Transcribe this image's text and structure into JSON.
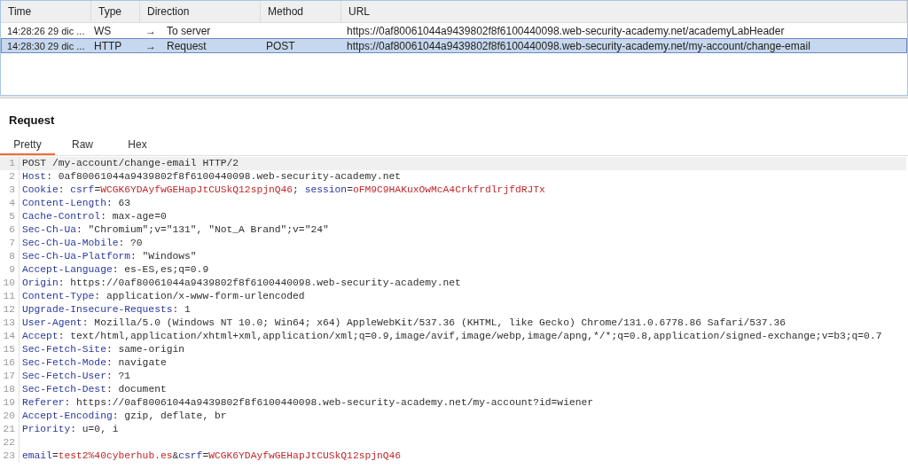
{
  "table": {
    "columns": [
      "Time",
      "Type",
      "Direction",
      "Method",
      "URL"
    ],
    "rows": [
      {
        "time": "14:28:26 29 dic ...",
        "type": "WS",
        "direction_arrow": "→",
        "direction": "To server",
        "url": "https://0af80061044a9439802f8f6100440098.web-security-academy.net/academyLabHeader",
        "selected": false
      },
      {
        "time": "14:28:30 29 dic ...",
        "type": "HTTP",
        "direction_arrow": "→",
        "direction": "Request",
        "method": "POST",
        "url": "https://0af80061044a9439802f8f6100440098.web-security-academy.net/my-account/change-email",
        "selected": true
      }
    ]
  },
  "panel": {
    "title": "Request",
    "tabs": [
      {
        "label": "Pretty",
        "selected": true
      },
      {
        "label": "Raw",
        "selected": false
      },
      {
        "label": "Hex",
        "selected": false
      }
    ],
    "lines": [
      {
        "number": "1",
        "tokens": [
          {
            "kind": "plain",
            "text": "POST /my-account/change-email HTTP/2"
          }
        ]
      },
      {
        "number": "2",
        "tokens": [
          {
            "kind": "name",
            "text": "Host"
          },
          {
            "kind": "plain",
            "text": ": 0af80061044a9439802f8f6100440098.web-security-academy.net"
          }
        ]
      },
      {
        "number": "3",
        "tokens": [
          {
            "kind": "name",
            "text": "Cookie"
          },
          {
            "kind": "plain",
            "text": ": "
          },
          {
            "kind": "name",
            "text": "csrf"
          },
          {
            "kind": "plain",
            "text": "="
          },
          {
            "kind": "value",
            "text": "WCGK6YDAyfwGEHapJtCUSkQ12spjnQ46"
          },
          {
            "kind": "plain",
            "text": "; "
          },
          {
            "kind": "name",
            "text": "session"
          },
          {
            "kind": "plain",
            "text": "="
          },
          {
            "kind": "value",
            "text": "oFM9C9HAKuxOwMcA4CrkfrdlrjfdRJTx"
          }
        ]
      },
      {
        "number": "4",
        "tokens": [
          {
            "kind": "name",
            "text": "Content-Length"
          },
          {
            "kind": "plain",
            "text": ": 63"
          }
        ]
      },
      {
        "number": "5",
        "tokens": [
          {
            "kind": "name",
            "text": "Cache-Control"
          },
          {
            "kind": "plain",
            "text": ": max-age=0"
          }
        ]
      },
      {
        "number": "6",
        "tokens": [
          {
            "kind": "name",
            "text": "Sec-Ch-Ua"
          },
          {
            "kind": "plain",
            "text": ": \"Chromium\";v=\"131\", \"Not_A Brand\";v=\"24\""
          }
        ]
      },
      {
        "number": "7",
        "tokens": [
          {
            "kind": "name",
            "text": "Sec-Ch-Ua-Mobile"
          },
          {
            "kind": "plain",
            "text": ": ?0"
          }
        ]
      },
      {
        "number": "8",
        "tokens": [
          {
            "kind": "name",
            "text": "Sec-Ch-Ua-Platform"
          },
          {
            "kind": "plain",
            "text": ": \"Windows\""
          }
        ]
      },
      {
        "number": "9",
        "tokens": [
          {
            "kind": "name",
            "text": "Accept-Language"
          },
          {
            "kind": "plain",
            "text": ": es-ES,es;q=0.9"
          }
        ]
      },
      {
        "number": "10",
        "tokens": [
          {
            "kind": "name",
            "text": "Origin"
          },
          {
            "kind": "plain",
            "text": ": https://0af80061044a9439802f8f6100440098.web-security-academy.net"
          }
        ]
      },
      {
        "number": "11",
        "tokens": [
          {
            "kind": "name",
            "text": "Content-Type"
          },
          {
            "kind": "plain",
            "text": ": application/x-www-form-urlencoded"
          }
        ]
      },
      {
        "number": "12",
        "tokens": [
          {
            "kind": "name",
            "text": "Upgrade-Insecure-Requests"
          },
          {
            "kind": "plain",
            "text": ": 1"
          }
        ]
      },
      {
        "number": "13",
        "tokens": [
          {
            "kind": "name",
            "text": "User-Agent"
          },
          {
            "kind": "plain",
            "text": ": Mozilla/5.0 (Windows NT 10.0; Win64; x64) AppleWebKit/537.36 (KHTML, like Gecko) Chrome/131.0.6778.86 Safari/537.36"
          }
        ]
      },
      {
        "number": "14",
        "tokens": [
          {
            "kind": "name",
            "text": "Accept"
          },
          {
            "kind": "plain",
            "text": ": text/html,application/xhtml+xml,application/xml;q=0.9,image/avif,image/webp,image/apng,*/*;q=0.8,application/signed-exchange;v=b3;q=0.7"
          }
        ]
      },
      {
        "number": "15",
        "tokens": [
          {
            "kind": "name",
            "text": "Sec-Fetch-Site"
          },
          {
            "kind": "plain",
            "text": ": same-origin"
          }
        ]
      },
      {
        "number": "16",
        "tokens": [
          {
            "kind": "name",
            "text": "Sec-Fetch-Mode"
          },
          {
            "kind": "plain",
            "text": ": navigate"
          }
        ]
      },
      {
        "number": "17",
        "tokens": [
          {
            "kind": "name",
            "text": "Sec-Fetch-User"
          },
          {
            "kind": "plain",
            "text": ": ?1"
          }
        ]
      },
      {
        "number": "18",
        "tokens": [
          {
            "kind": "name",
            "text": "Sec-Fetch-Dest"
          },
          {
            "kind": "plain",
            "text": ": document"
          }
        ]
      },
      {
        "number": "19",
        "tokens": [
          {
            "kind": "name",
            "text": "Referer"
          },
          {
            "kind": "plain",
            "text": ": https://0af80061044a9439802f8f6100440098.web-security-academy.net/my-account?id=wiener"
          }
        ]
      },
      {
        "number": "20",
        "tokens": [
          {
            "kind": "name",
            "text": "Accept-Encoding"
          },
          {
            "kind": "plain",
            "text": ": gzip, deflate, br"
          }
        ]
      },
      {
        "number": "21",
        "tokens": [
          {
            "kind": "name",
            "text": "Priority"
          },
          {
            "kind": "plain",
            "text": ": u=0, i"
          }
        ]
      },
      {
        "number": "22"
      },
      {
        "number": "23",
        "tokens": [
          {
            "kind": "name",
            "text": "email"
          },
          {
            "kind": "plain",
            "text": "="
          },
          {
            "kind": "value",
            "text": "test2%40cyberhub.es"
          },
          {
            "kind": "plain",
            "text": "&"
          },
          {
            "kind": "name",
            "text": "csrf"
          },
          {
            "kind": "plain",
            "text": "="
          },
          {
            "kind": "value",
            "text": "WCGK6YDAyfwGEHapJtCUSkQ12spjnQ46"
          }
        ]
      }
    ]
  }
}
